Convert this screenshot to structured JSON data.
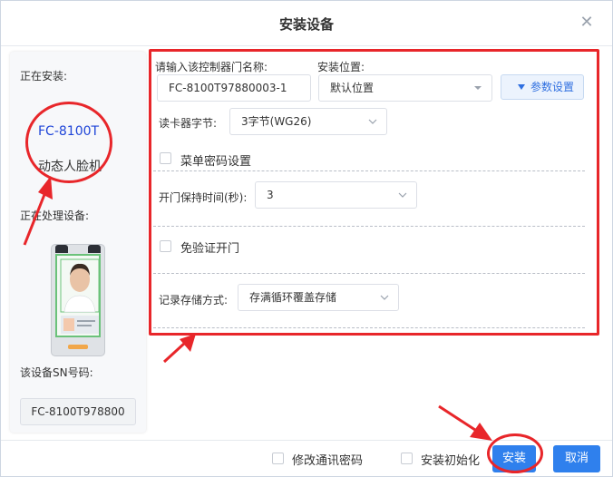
{
  "dialog": {
    "title": "安装设备"
  },
  "left": {
    "installing_label": "正在安装:",
    "model": "FC-8100T",
    "device_type": "动态人脸机",
    "processing_label": "正在处理设备:",
    "sn_label": "该设备SN号码:",
    "sn_value": "FC-8100T978800"
  },
  "form": {
    "door_name_label": "请输入该控制器门名称:",
    "door_name_value": "FC-8100T97880003-1",
    "location_label": "安装位置:",
    "location_value": "默认位置",
    "param_button": "参数设置",
    "card_byte_label": "读卡器字节:",
    "card_byte_value": "3字节(WG26)",
    "menu_password_label": "菜单密码设置",
    "hold_time_label": "开门保持时间(秒):",
    "hold_time_value": "3",
    "no_verify_label": "免验证开门",
    "storage_label": "记录存储方式:",
    "storage_value": "存满循环覆盖存储"
  },
  "footer": {
    "modify_password_label": "修改通讯密码",
    "install_init_label": "安装初始化",
    "install_button": "安装",
    "cancel_button": "取消"
  },
  "colors": {
    "accent": "#2f80ed",
    "annotation": "#e8262a"
  },
  "icons": [
    "close-icon",
    "chevron-down-icon",
    "caret-down-icon",
    "face-terminal-image"
  ]
}
